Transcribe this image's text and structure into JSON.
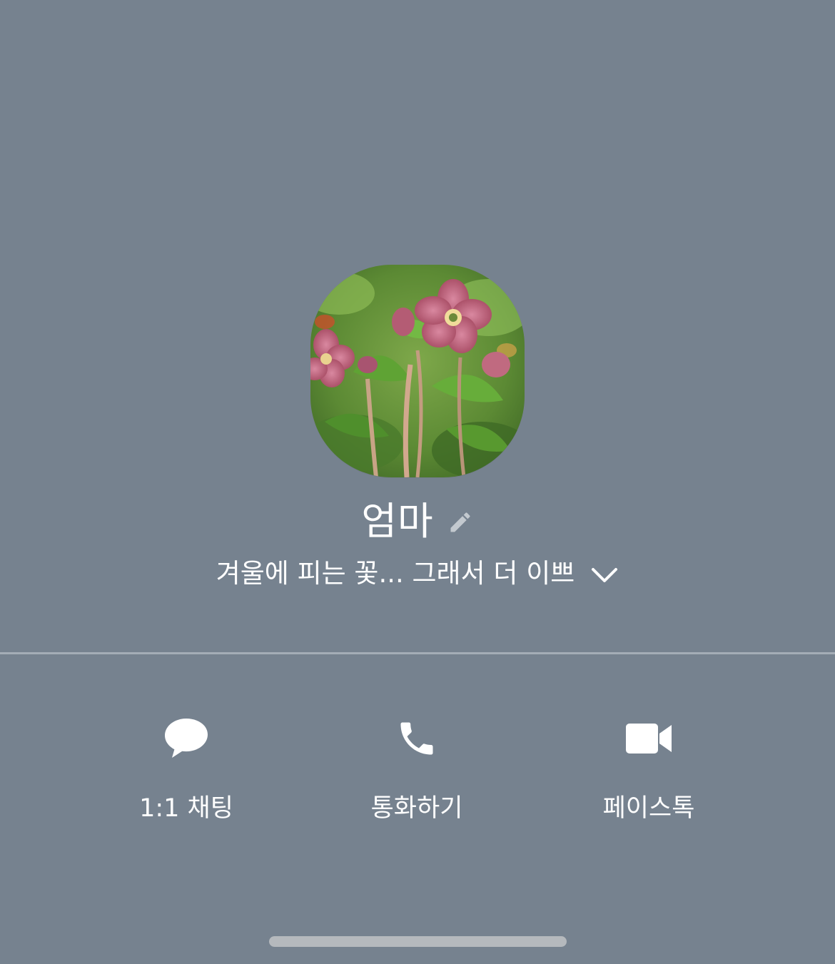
{
  "profile": {
    "name": "엄마",
    "status_message": "겨울에 피는 꽃... 그래서 더 이쁘",
    "avatar_alt": "profile-photo",
    "edit_icon": "pencil-icon",
    "expand_icon": "chevron-down-icon"
  },
  "actions": [
    {
      "label": "1:1 채팅",
      "icon": "chat-bubble-icon"
    },
    {
      "label": "통화하기",
      "icon": "phone-icon"
    },
    {
      "label": "페이스톡",
      "icon": "video-camera-icon"
    }
  ],
  "colors": {
    "background": "#76828f",
    "text": "#ffffff",
    "divider": "#a4adb6",
    "home_indicator": "#b5b9bd"
  }
}
